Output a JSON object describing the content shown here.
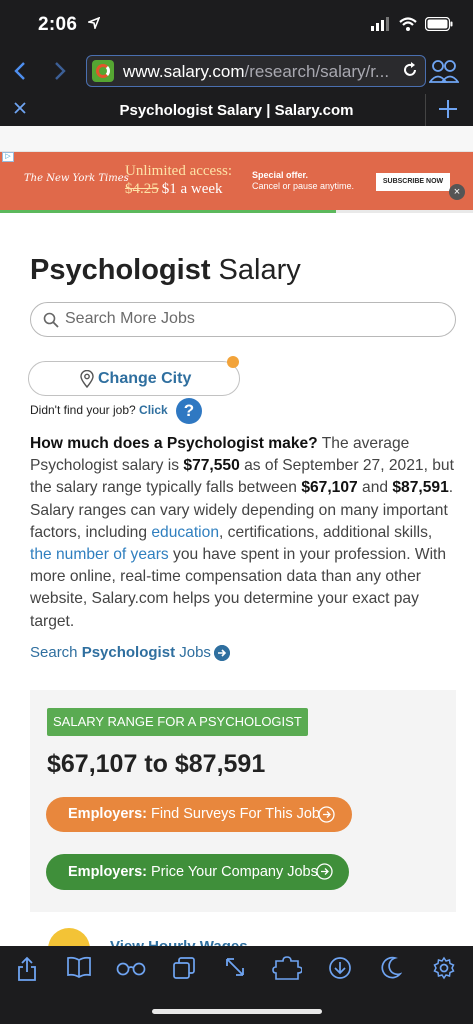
{
  "status": {
    "time": "2:06"
  },
  "browser": {
    "url_host": "www.salary.com",
    "url_path": "/research/salary/r...",
    "tab_title": "Psychologist Salary | Salary.com"
  },
  "ad": {
    "logo": "The New York Times",
    "headline": "Unlimited access:",
    "price_old": "$4.25",
    "price_new": "$1 a week",
    "offer_title": "Special offer.",
    "offer_sub": "Cancel or pause anytime.",
    "button": "SUBSCRIBE NOW",
    "close": "×"
  },
  "page": {
    "title_bold": "Psychologist",
    "title_rest": " Salary",
    "search_placeholder": "Search More Jobs",
    "change_city": "Change City",
    "didnt_find": "Didn't find your job?",
    "click": "Click",
    "help": "?",
    "para": {
      "q": "How much does a Psychologist make?",
      "t1": " The average Psychologist salary is ",
      "avg": "$77,550",
      "t2": " as of September 27, 2021, but the salary range typically falls between ",
      "low": "$67,107",
      "t3": " and ",
      "high": "$87,591",
      "t4": ". Salary ranges can vary widely depending on many important factors, including ",
      "link1": "education",
      "t5": ", certifications, additional skills, ",
      "link2": "the number of years",
      "t6": " you have spent in your profession. With more online, real-time compensation data than any other website, Salary.com helps you determine your exact pay target."
    },
    "search_jobs_pre": "Search ",
    "search_jobs_bold": "Psychologist",
    "search_jobs_post": " Jobs"
  },
  "range": {
    "tag": "SALARY RANGE FOR A PSYCHOLOGIST",
    "value": "$67,107 to $87,591",
    "btn1_bold": "Employers:",
    "btn1_rest": " Find Surveys For This Job",
    "btn2_bold": "Employers:",
    "btn2_rest": " Price Your Company Jobs",
    "peek": "View Hourly Wages"
  },
  "colors": {
    "accent_blue": "#2f6f9f",
    "orange_button": "#e8873d",
    "green_button": "#3f8f3a",
    "tag_green": "#5aab52"
  },
  "loading_progress": 0.71
}
